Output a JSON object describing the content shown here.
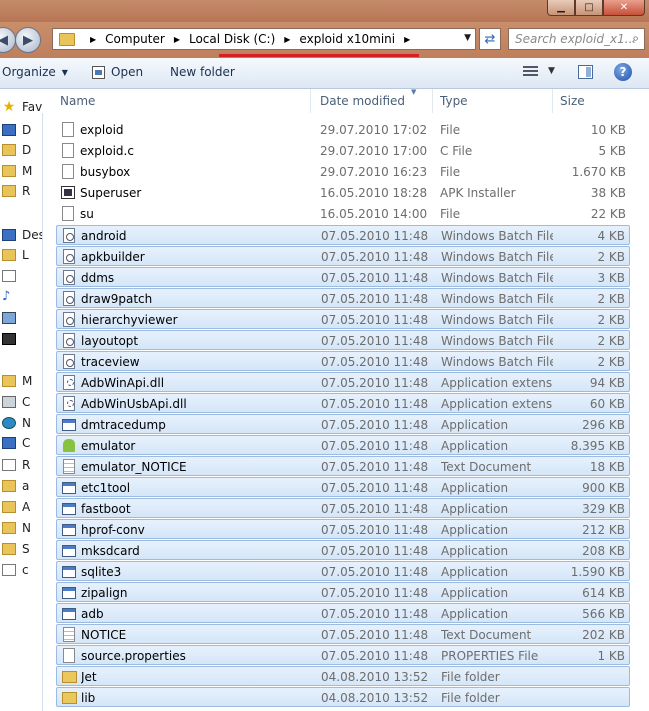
{
  "window": {
    "buttons": {
      "minimize": "▁",
      "maximize": "□",
      "close": "✕"
    }
  },
  "address": {
    "crumbs": [
      "Computer",
      "Local Disk (C:)",
      "exploid x10mini"
    ],
    "search_placeholder": "Search exploid_x1..."
  },
  "toolbar": {
    "organize": "Organize",
    "open": "Open",
    "new_folder": "New folder",
    "help": "?"
  },
  "nav": [
    {
      "label": "Fav",
      "icon": "star"
    },
    {
      "label": "D",
      "icon": "monitor"
    },
    {
      "label": "D",
      "icon": "folder"
    },
    {
      "label": "M",
      "icon": "folder"
    },
    {
      "label": "R",
      "icon": "folder"
    },
    {
      "label": "Des",
      "icon": "monitor"
    },
    {
      "label": "L",
      "icon": "folder"
    },
    {
      "label": "",
      "icon": "doc"
    },
    {
      "label": "",
      "icon": "music"
    },
    {
      "label": "",
      "icon": "pic"
    },
    {
      "label": "",
      "icon": "film"
    },
    {
      "label": "M",
      "icon": "folder"
    },
    {
      "label": "C",
      "icon": "drive"
    },
    {
      "label": "N",
      "icon": "net"
    },
    {
      "label": "C",
      "icon": "monitor"
    },
    {
      "label": "R",
      "icon": "doc"
    },
    {
      "label": "a",
      "icon": "folder"
    },
    {
      "label": "A",
      "icon": "folder"
    },
    {
      "label": "N",
      "icon": "folder"
    },
    {
      "label": "S",
      "icon": "folder"
    },
    {
      "label": "c",
      "icon": "doc"
    }
  ],
  "columns": {
    "name": "Name",
    "date": "Date modified",
    "type": "Type",
    "size": "Size"
  },
  "files": [
    {
      "name": "exploid",
      "date": "29.07.2010 17:02",
      "type": "File",
      "size": "10 KB",
      "icon": "file",
      "selected": false
    },
    {
      "name": "exploid.c",
      "date": "29.07.2010 17:00",
      "type": "C File",
      "size": "5 KB",
      "icon": "file",
      "selected": false
    },
    {
      "name": "busybox",
      "date": "29.07.2010 16:23",
      "type": "File",
      "size": "1.670 KB",
      "icon": "file",
      "selected": false
    },
    {
      "name": "Superuser",
      "date": "16.05.2010 18:28",
      "type": "APK Installer",
      "size": "38 KB",
      "icon": "apk",
      "selected": false
    },
    {
      "name": "su",
      "date": "16.05.2010 14:00",
      "type": "File",
      "size": "22 KB",
      "icon": "file",
      "selected": false
    },
    {
      "name": "android",
      "date": "07.05.2010 11:48",
      "type": "Windows Batch File",
      "size": "4 KB",
      "icon": "batch",
      "selected": true
    },
    {
      "name": "apkbuilder",
      "date": "07.05.2010 11:48",
      "type": "Windows Batch File",
      "size": "2 KB",
      "icon": "batch",
      "selected": true
    },
    {
      "name": "ddms",
      "date": "07.05.2010 11:48",
      "type": "Windows Batch File",
      "size": "3 KB",
      "icon": "batch",
      "selected": true
    },
    {
      "name": "draw9patch",
      "date": "07.05.2010 11:48",
      "type": "Windows Batch File",
      "size": "2 KB",
      "icon": "batch",
      "selected": true
    },
    {
      "name": "hierarchyviewer",
      "date": "07.05.2010 11:48",
      "type": "Windows Batch File",
      "size": "2 KB",
      "icon": "batch",
      "selected": true
    },
    {
      "name": "layoutopt",
      "date": "07.05.2010 11:48",
      "type": "Windows Batch File",
      "size": "2 KB",
      "icon": "batch",
      "selected": true
    },
    {
      "name": "traceview",
      "date": "07.05.2010 11:48",
      "type": "Windows Batch File",
      "size": "2 KB",
      "icon": "batch",
      "selected": true
    },
    {
      "name": "AdbWinApi.dll",
      "date": "07.05.2010 11:48",
      "type": "Application extens...",
      "size": "94 KB",
      "icon": "dll",
      "selected": true
    },
    {
      "name": "AdbWinUsbApi.dll",
      "date": "07.05.2010 11:48",
      "type": "Application extens...",
      "size": "60 KB",
      "icon": "dll",
      "selected": true
    },
    {
      "name": "dmtracedump",
      "date": "07.05.2010 11:48",
      "type": "Application",
      "size": "296 KB",
      "icon": "exe",
      "selected": true
    },
    {
      "name": "emulator",
      "date": "07.05.2010 11:48",
      "type": "Application",
      "size": "8.395 KB",
      "icon": "android",
      "selected": true
    },
    {
      "name": "emulator_NOTICE",
      "date": "07.05.2010 11:48",
      "type": "Text Document",
      "size": "18 KB",
      "icon": "text",
      "selected": true
    },
    {
      "name": "etc1tool",
      "date": "07.05.2010 11:48",
      "type": "Application",
      "size": "900 KB",
      "icon": "exe",
      "selected": true
    },
    {
      "name": "fastboot",
      "date": "07.05.2010 11:48",
      "type": "Application",
      "size": "329 KB",
      "icon": "exe",
      "selected": true
    },
    {
      "name": "hprof-conv",
      "date": "07.05.2010 11:48",
      "type": "Application",
      "size": "212 KB",
      "icon": "exe",
      "selected": true
    },
    {
      "name": "mksdcard",
      "date": "07.05.2010 11:48",
      "type": "Application",
      "size": "208 KB",
      "icon": "exe",
      "selected": true
    },
    {
      "name": "sqlite3",
      "date": "07.05.2010 11:48",
      "type": "Application",
      "size": "1.590 KB",
      "icon": "exe",
      "selected": true
    },
    {
      "name": "zipalign",
      "date": "07.05.2010 11:48",
      "type": "Application",
      "size": "614 KB",
      "icon": "exe",
      "selected": true
    },
    {
      "name": "adb",
      "date": "07.05.2010 11:48",
      "type": "Application",
      "size": "566 KB",
      "icon": "exe",
      "selected": true
    },
    {
      "name": "NOTICE",
      "date": "07.05.2010 11:48",
      "type": "Text Document",
      "size": "202 KB",
      "icon": "text",
      "selected": true
    },
    {
      "name": "source.properties",
      "date": "07.05.2010 11:48",
      "type": "PROPERTIES File",
      "size": "1 KB",
      "icon": "file",
      "selected": true
    },
    {
      "name": "Jet",
      "date": "04.08.2010 13:52",
      "type": "File folder",
      "size": "",
      "icon": "folder",
      "selected": true
    },
    {
      "name": "lib",
      "date": "04.08.2010 13:52",
      "type": "File folder",
      "size": "",
      "icon": "folder",
      "selected": true
    }
  ]
}
